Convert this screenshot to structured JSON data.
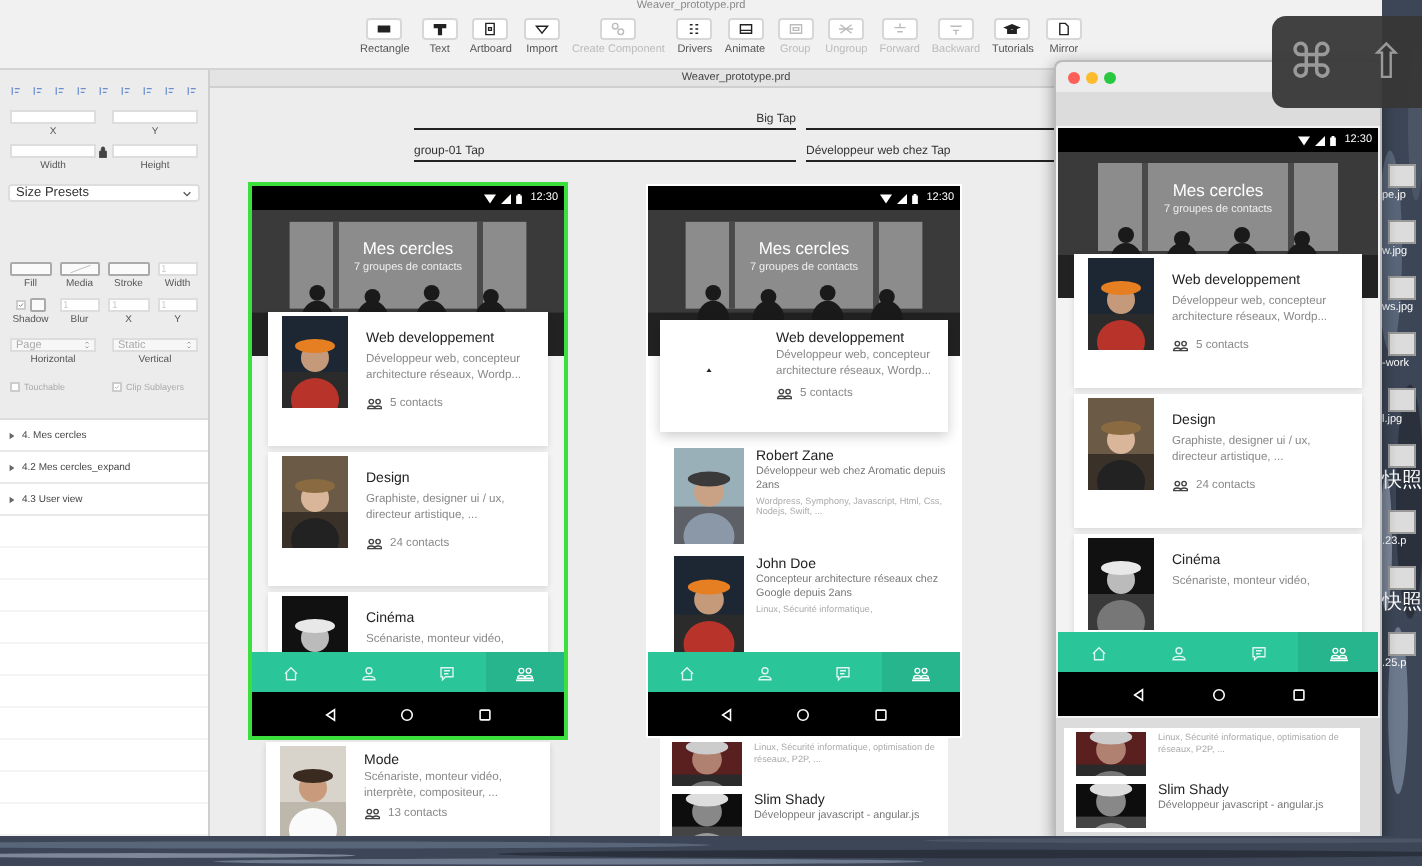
{
  "window": {
    "title": "Weaver_prototype.prd"
  },
  "toolbar": [
    {
      "label": "Rectangle",
      "disabled": false
    },
    {
      "label": "Text",
      "disabled": false
    },
    {
      "label": "Artboard",
      "disabled": false
    },
    {
      "label": "Import",
      "disabled": false
    },
    {
      "label": "Create Component",
      "disabled": true
    },
    {
      "label": "Drivers",
      "disabled": false
    },
    {
      "label": "Animate",
      "disabled": false
    },
    {
      "label": "Group",
      "disabled": true
    },
    {
      "label": "Ungroup",
      "disabled": true
    },
    {
      "label": "Forward",
      "disabled": true
    },
    {
      "label": "Backward",
      "disabled": true
    },
    {
      "label": "Tutorials",
      "disabled": false
    },
    {
      "label": "Mirror",
      "disabled": false
    }
  ],
  "document_tab": {
    "title": "Weaver_prototype.prd"
  },
  "inspector": {
    "position": [
      {
        "label": "X"
      },
      {
        "label": "Y"
      }
    ],
    "size": [
      {
        "label": "Width"
      },
      {
        "label": "Height"
      }
    ],
    "size_presets": "Size Presets",
    "style": [
      {
        "label": "Fill",
        "kind": "swatch"
      },
      {
        "label": "Media",
        "kind": "media"
      },
      {
        "label": "Stroke",
        "kind": "swatch"
      },
      {
        "label": "Width",
        "kind": "field",
        "value": "1"
      }
    ],
    "shadow_row": [
      {
        "label": "Shadow",
        "kind": "check",
        "checked": true
      },
      {
        "label": "Blur",
        "kind": "field",
        "value": "1"
      },
      {
        "label": "X",
        "kind": "field",
        "value": "1"
      },
      {
        "label": "Y",
        "kind": "field",
        "value": "1"
      }
    ],
    "placement": [
      {
        "label": "Horizontal",
        "value": "Page"
      },
      {
        "label": "Vertical",
        "value": "Static"
      }
    ],
    "options": [
      {
        "label": "Touchable",
        "checked": false
      },
      {
        "label": "Clip Sublayers",
        "checked": true
      }
    ]
  },
  "layers": [
    {
      "label": "4. Mes cercles",
      "expanded": false
    },
    {
      "label": "4.2 Mes cercles_expand",
      "expanded": false
    },
    {
      "label": "4.3 User view",
      "expanded": false
    }
  ],
  "links": [
    {
      "label": "Big Tap"
    },
    {
      "label": "group-01 Tap"
    },
    {
      "label": "Développeur web chez Tap"
    }
  ],
  "artboards": [
    {
      "selected": true,
      "status_time": "12:30",
      "title": "Mes cercles",
      "subtitle": "7 groupes de contacts",
      "items": [
        {
          "kind": "group",
          "title": "Web developpement",
          "description": "Développeur web, concepteur architecture réseaux, Wordp...",
          "count": "5 contacts"
        },
        {
          "kind": "group",
          "title": "Design",
          "description": "Graphiste, designer ui / ux, directeur artistique, ...",
          "count": "24 contacts"
        },
        {
          "kind": "group",
          "title": "Cinéma",
          "description": "Scénariste, monteur vidéo,"
        }
      ],
      "tabs": [
        {
          "selected": false
        },
        {
          "selected": false
        },
        {
          "selected": false
        },
        {
          "selected": true
        }
      ],
      "below": [
        {
          "kind": "group",
          "title": "Mode",
          "description": "Scénariste, monteur vidéo, interprète, compositeur, ...",
          "count": "13 contacts"
        }
      ]
    },
    {
      "selected": false,
      "status_time": "12:30",
      "title": "Mes cercles",
      "subtitle": "7 groupes de contacts",
      "items": [
        {
          "kind": "expanded",
          "title": "Web developpement",
          "description": "Développeur web, concepteur architecture réseaux, Wordp...",
          "count": "5 contacts"
        },
        {
          "kind": "user",
          "title": "Robert Zane",
          "description": "Développeur web chez Aromatic depuis 2ans",
          "detail": "Wordpress, Symphony, Javascript, Html, Css, Nodejs, Swift, ..."
        },
        {
          "kind": "user",
          "title": "John Doe",
          "description": "Concepteur architecture réseaux chez Google depuis 2ans",
          "detail": "Linux, Sécurité informatique,"
        }
      ],
      "tabs": [
        {
          "selected": false
        },
        {
          "selected": false
        },
        {
          "selected": false
        },
        {
          "selected": true
        }
      ],
      "below": [
        {
          "kind": "user",
          "detail": "Linux, Sécurité informatique, optimisation de réseaux, P2P, ..."
        },
        {
          "kind": "user",
          "title": "Slim Shady",
          "description": "Développeur javascript - angular.js"
        }
      ]
    }
  ],
  "preview_window": {
    "artboard": {
      "selected": false,
      "status_time": "12:30",
      "title": "Mes cercles",
      "subtitle": "7 groupes de contacts",
      "items": [
        {
          "kind": "group",
          "title": "Web developpement",
          "description": "Développeur web, concepteur architecture réseaux, Wordp...",
          "count": "5 contacts"
        },
        {
          "kind": "group",
          "title": "Design",
          "description": "Graphiste, designer ui / ux, directeur artistique, ...",
          "count": "24 contacts"
        },
        {
          "kind": "group",
          "title": "Cinéma",
          "description": "Scénariste, monteur vidéo,"
        }
      ],
      "tabs": [
        {
          "selected": false
        },
        {
          "selected": false
        },
        {
          "selected": false
        },
        {
          "selected": true
        }
      ],
      "below": [
        {
          "kind": "user",
          "detail": "Linux, Sécurité informatique, optimisation de réseaux, P2P, ..."
        },
        {
          "kind": "user",
          "title": "Slim Shady",
          "description": "Développeur javascript - angular.js"
        }
      ]
    }
  },
  "key_overlay": [
    "⌘",
    "⇧"
  ],
  "desktop_files": [
    {
      "label": "pe.jp"
    },
    {
      "label": "w.jpg"
    },
    {
      "label": "ws.jpg"
    },
    {
      "label": "-work"
    },
    {
      "label": "l.jpg"
    },
    {
      "label": "快照"
    },
    {
      "label": ".23.p"
    },
    {
      "label": "快照"
    },
    {
      "label": ".25.p"
    }
  ]
}
